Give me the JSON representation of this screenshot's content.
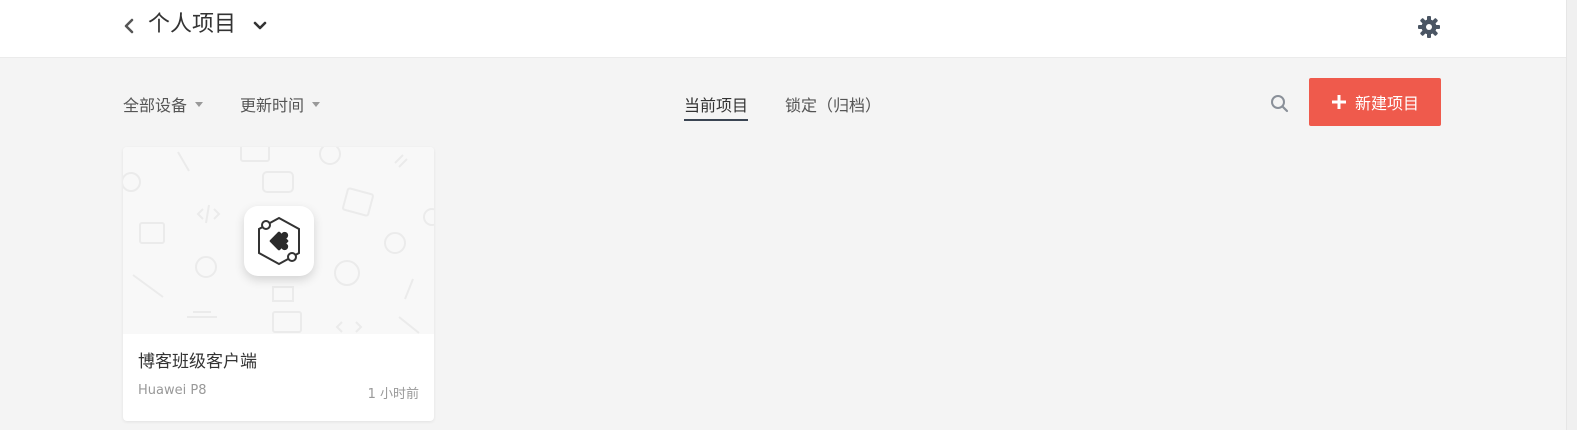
{
  "header": {
    "title": "个人项目",
    "back_icon": "chevron-left-icon",
    "dropdown_icon": "chevron-down-icon",
    "settings_icon": "gear-icon"
  },
  "toolbar": {
    "device_filter": "全部设备",
    "sort_filter": "更新时间",
    "tabs": [
      {
        "label": "当前项目",
        "active": true
      },
      {
        "label": "锁定（归档）",
        "active": false
      }
    ],
    "search_icon": "search-icon",
    "new_project_label": "新建项目"
  },
  "projects": [
    {
      "name": "博客班级客户端",
      "device": "Huawei P8",
      "updated": "1 小时前",
      "icon": "puzzle-hexagon-icon"
    }
  ],
  "colors": {
    "accent": "#ef5a4c",
    "tab_underline": "#3a4452",
    "background": "#f4f4f4"
  }
}
